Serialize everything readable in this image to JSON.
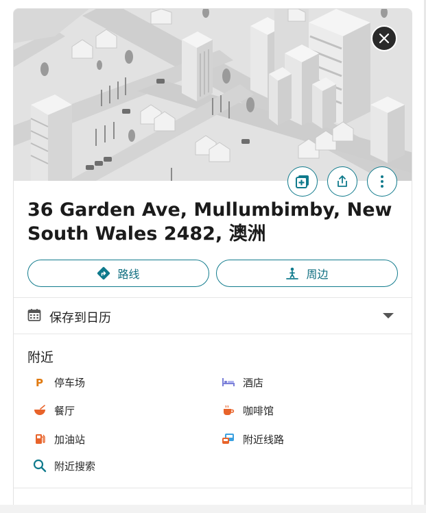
{
  "place": {
    "title": "36 Garden Ave, Mullumbimby, New South Wales 2482, 澳洲"
  },
  "actions": {
    "route_label": "路线",
    "nearby_label": "周边"
  },
  "calendar": {
    "label": "保存到日历"
  },
  "nearby": {
    "heading": "附近",
    "items": [
      {
        "label": "停车场",
        "icon": "parking-icon"
      },
      {
        "label": "酒店",
        "icon": "hotel-bed-icon"
      },
      {
        "label": "餐厅",
        "icon": "restaurant-bowl-icon"
      },
      {
        "label": "咖啡馆",
        "icon": "coffee-cup-icon"
      },
      {
        "label": "加油站",
        "icon": "gas-station-icon"
      },
      {
        "label": "附近线路",
        "icon": "transit-icon"
      },
      {
        "label": "附近搜索",
        "icon": "search-icon"
      }
    ]
  },
  "icons": {
    "close": "close-icon",
    "save": "add-to-collection-icon",
    "share": "share-icon",
    "more": "more-vertical-icon",
    "route": "directions-icon",
    "nearby": "person-nearby-icon",
    "calendar": "calendar-icon",
    "expand": "chevron-down-icon"
  },
  "colors": {
    "accent": "#0f7a8c",
    "parking": "#e07a10",
    "hotel": "#7a7fd8",
    "restaurant": "#e8632a",
    "coffee": "#e8632a",
    "gas": "#e8632a",
    "transit": "#3aa0e0"
  }
}
